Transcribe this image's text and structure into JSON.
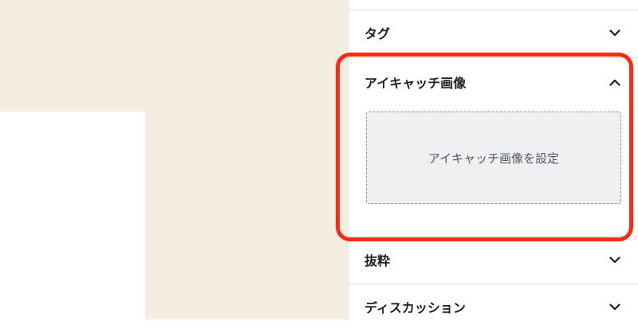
{
  "sidebar": {
    "panels": [
      {
        "title": "タグ",
        "expanded": false,
        "icon": "chevron-down-icon"
      },
      {
        "title": "アイキャッチ画像",
        "expanded": true,
        "icon": "chevron-up-icon"
      },
      {
        "title": "抜粋",
        "expanded": false,
        "icon": "chevron-down-icon"
      },
      {
        "title": "ディスカッション",
        "expanded": false,
        "icon": "chevron-down-icon"
      }
    ],
    "featured_image": {
      "button_label": "アイキャッチ画像を設定"
    }
  },
  "annotation": {
    "highlight_color": "#ff2a16"
  },
  "colors": {
    "canvas_background": "#f4ede0",
    "placeholder_background": "#eff0f1"
  }
}
